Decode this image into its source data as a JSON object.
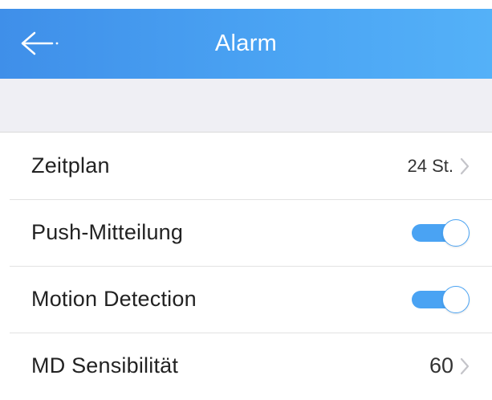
{
  "header": {
    "title": "Alarm",
    "back_icon": "arrow-left-icon",
    "color_start": "#3f8fe9",
    "color_end": "#54b1f8"
  },
  "settings": {
    "zeitplan": {
      "label": "Zeitplan",
      "value": "24 St.",
      "icon": "chevron-right-icon"
    },
    "push": {
      "label": "Push-Mitteilung",
      "enabled": true
    },
    "motion": {
      "label": "Motion Detection",
      "enabled": true
    },
    "md_sensitivity": {
      "label": "MD Sensibilität",
      "value": "60",
      "icon": "chevron-right-icon"
    }
  },
  "colors": {
    "accent": "#4aa3f3",
    "background": "#efeff4",
    "divider": "#e2e2e2"
  }
}
